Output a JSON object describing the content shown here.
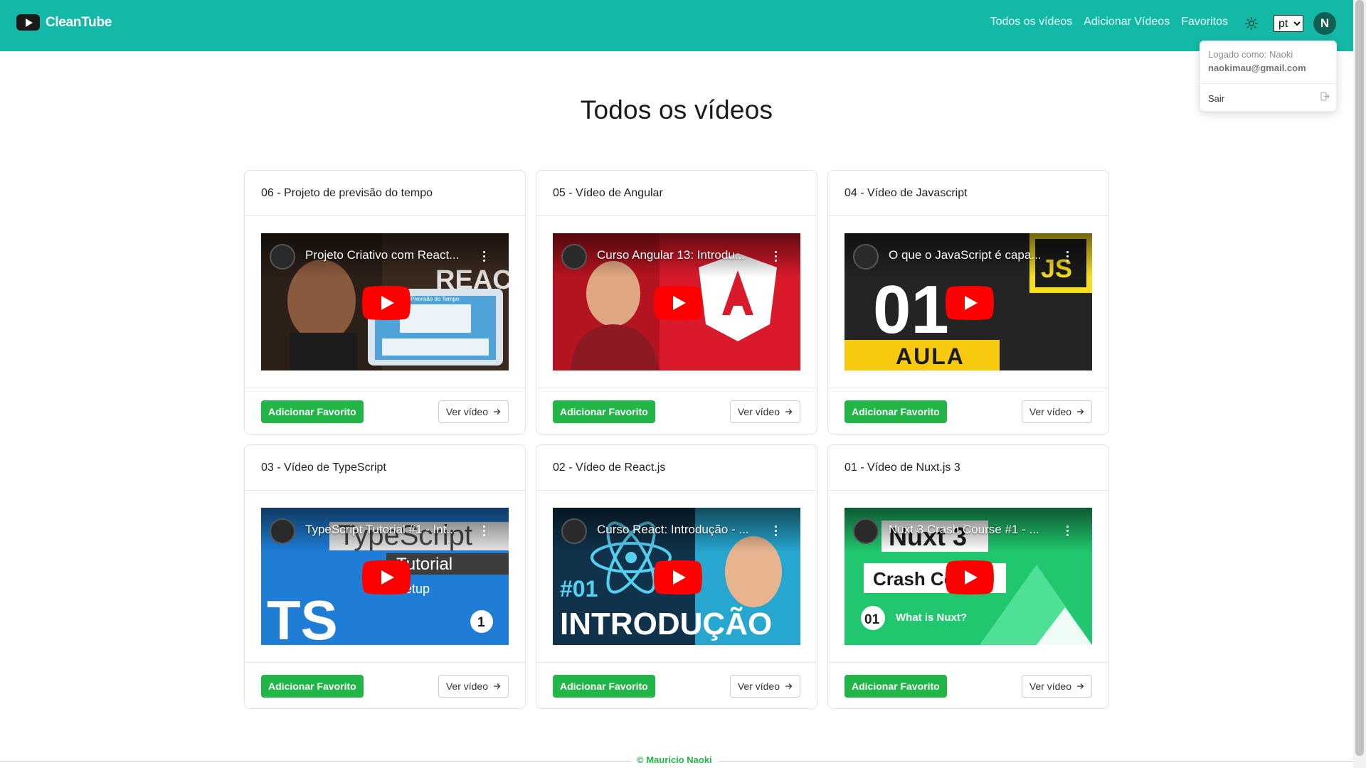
{
  "app": {
    "name": "CleanTube",
    "brand_color": "#14b8a6",
    "accent_green": "#22b547"
  },
  "nav": {
    "links": [
      "Todos os vídeos",
      "Adicionar Vídeos",
      "Favoritos"
    ],
    "theme_icon": "sun-icon",
    "language": "pt",
    "avatar_initial": "N"
  },
  "dropdown": {
    "logged_as": "Logado como: Naoki",
    "email": "naokimau@gmail.com",
    "logout_label": "Sair",
    "logout_icon": "logout-icon"
  },
  "page": {
    "title": "Todos os vídeos"
  },
  "videos": [
    {
      "title": "06 - Projeto de previsão do tempo",
      "embed_title": "Projeto Criativo com React...",
      "art": "weather"
    },
    {
      "title": "05 - Vídeo de Angular",
      "embed_title": "Curso Angular 13: Introdu...",
      "art": "angular"
    },
    {
      "title": "04 - Vídeo de Javascript",
      "embed_title": "O que o JavaScript é capa...",
      "art": "javascript"
    },
    {
      "title": "03 - Vídeo de TypeScript",
      "embed_title": "TypeScript Tutorial #1 - Int...",
      "art": "typescript"
    },
    {
      "title": "02 - Vídeo de React.js",
      "embed_title": "Curso React: Introdução - ...",
      "art": "react"
    },
    {
      "title": "01 - Vídeo de Nuxt.js 3",
      "embed_title": "Nuxt 3 Crash Course #1 - ...",
      "art": "nuxt"
    }
  ],
  "card_actions": {
    "favorite_label": "Adicionar Favorito",
    "view_label": "Ver vídeo"
  },
  "thumb_text": {
    "weather_word": "REACT",
    "weather_panel": "Previsão do Tempo",
    "js_number": "01",
    "js_word": "AULA",
    "js_badge": "JS",
    "ts_word": "TypeScript",
    "ts_sub": "Tutorial",
    "ts_badge": "TS",
    "ts_setup": "Setup",
    "ts_number": "1",
    "react_number": "#01",
    "react_word": "INTRODUÇÃO",
    "nuxt_word": "Nuxt 3",
    "nuxt_sub": "Crash Course",
    "nuxt_number": "01",
    "nuxt_q": "What is Nuxt?"
  },
  "footer": {
    "text": "© Maurício Naoki"
  }
}
